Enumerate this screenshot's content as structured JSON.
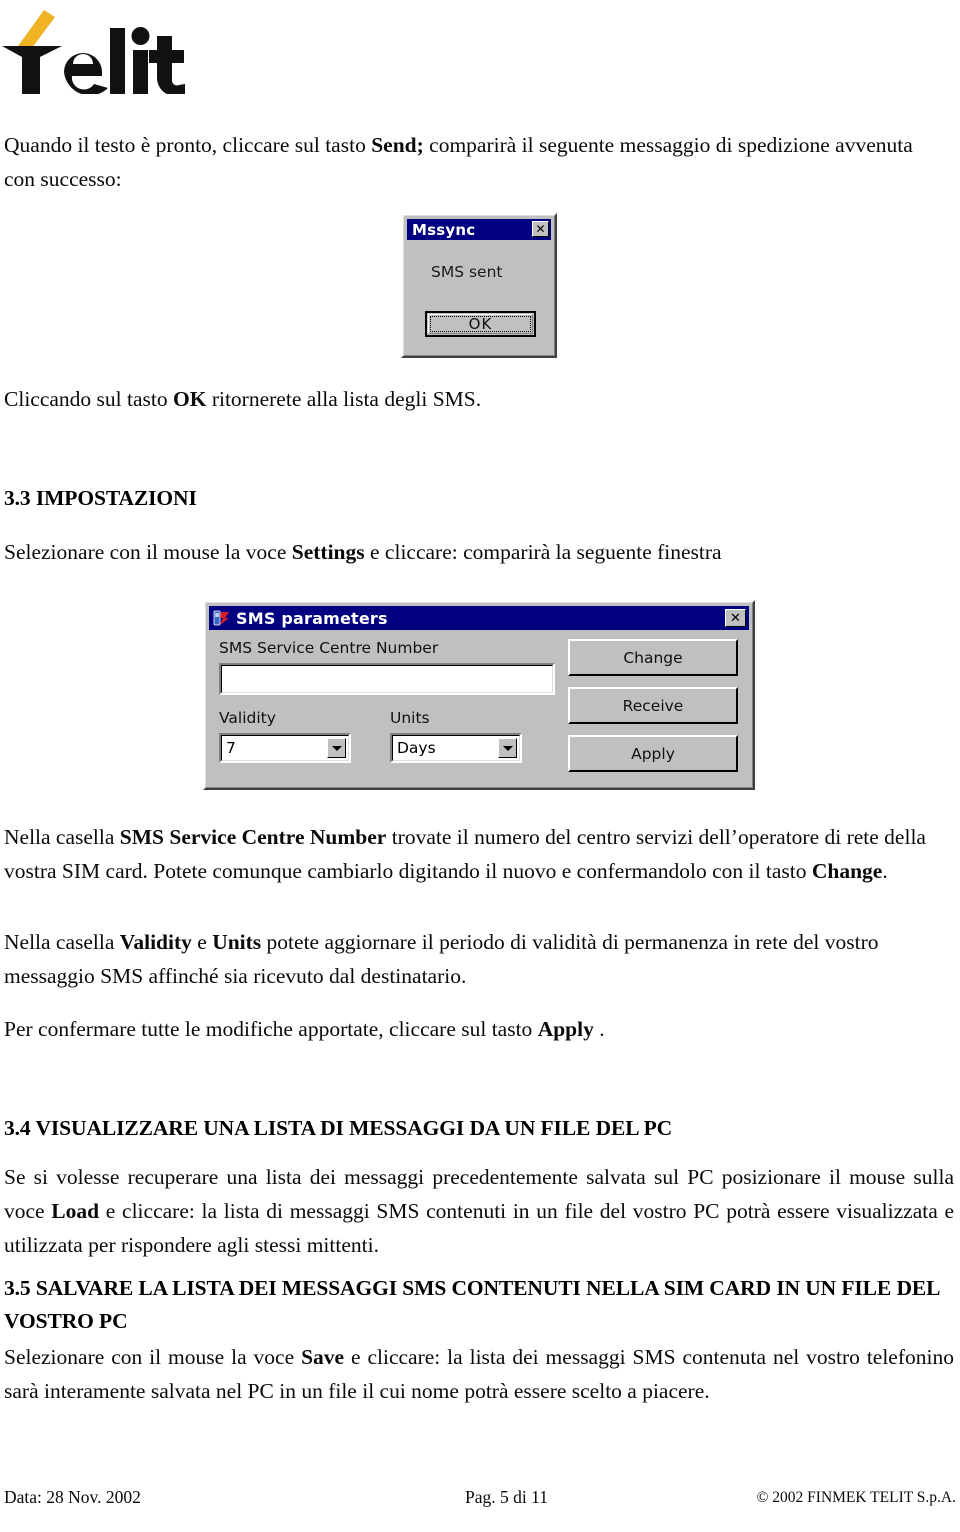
{
  "logo": {
    "wordmark": "Telit",
    "accent_color": "#F0B323",
    "text_color": "#0A0A0A"
  },
  "body": {
    "intro_paragraph": {
      "part1": "Quando il testo è pronto, cliccare sul tasto ",
      "bold1": "Send;",
      "part2": " comparirà il seguente messaggio di spedizione avvenuta con successo:"
    },
    "after_mssync": {
      "part1": "Cliccando sul tasto ",
      "bold1": "OK",
      "part2": " ritornerete alla lista degli SMS."
    },
    "section_33": {
      "heading": "3.3 IMPOSTAZIONI",
      "paragraph": {
        "part1": "Selezionare con il mouse la voce ",
        "bold1": "Settings",
        "part2": " e cliccare: comparirà la seguente finestra"
      }
    },
    "para_service_centre": {
      "part1": "Nella casella ",
      "bold1": "SMS Service Centre Number",
      "part2": "  trovate il numero del centro servizi dell’operatore di rete della vostra SIM card. Potete comunque cambiarlo digitando il nuovo e confermandolo con il tasto ",
      "bold2": "Change",
      "part3": "."
    },
    "para_validity": {
      "part1": "Nella casella ",
      "bold1": "Validity",
      "part2": " e ",
      "bold2": "Units",
      "part3": " potete aggiornare il periodo di validità di permanenza in rete del vostro messaggio SMS affinché sia ricevuto dal destinatario."
    },
    "para_apply": {
      "part1": "Per confermare tutte le modifiche apportate, cliccare sul tasto ",
      "bold1": "Apply",
      "part2": " ."
    },
    "section_34": {
      "heading": "3.4 VISUALIZZARE UNA LISTA DI MESSAGGI DA UN FILE DEL PC",
      "paragraph": {
        "part1": "Se si volesse recuperare una lista dei messaggi precedentemente salvata sul PC posizionare il mouse sulla voce ",
        "bold1": "Load",
        "part2": " e cliccare: la lista di messaggi SMS contenuti in un file del vostro PC potrà essere visualizzata e utilizzata per rispondere agli stessi mittenti."
      }
    },
    "section_35": {
      "heading": "3.5 SALVARE LA LISTA DEI MESSAGGI SMS CONTENUTI NELLA SIM CARD IN UN FILE DEL VOSTRO PC",
      "paragraph": {
        "part1": "Selezionare con il mouse la voce ",
        "bold1": "Save",
        "part2": " e cliccare: la lista dei messaggi SMS contenuta nel vostro telefonino sarà interamente salvata nel PC in un file il cui nome potrà essere scelto a piacere."
      }
    }
  },
  "mssync_dialog": {
    "title": "Mssync",
    "close_glyph": "✕",
    "message": "SMS sent",
    "ok_label": "OK",
    "titlebar_color": "#000080",
    "face_color": "#C0C0C0"
  },
  "sms_parameters_dialog": {
    "title": "SMS parameters",
    "close_glyph": "✕",
    "service_centre_label": "SMS Service Centre Number",
    "service_centre_value": "",
    "validity_label": "Validity",
    "validity_value": "7",
    "units_label": "Units",
    "units_value": "Days",
    "buttons": {
      "change": "Change",
      "receive": "Receive",
      "apply": "Apply"
    },
    "titlebar_color": "#000080",
    "face_color": "#C0C0C0"
  },
  "footer": {
    "date": "Data: 28 Nov. 2002",
    "page": "Pag. 5 di 11",
    "copyright": "© 2002 FINMEK TELIT S.p.A."
  }
}
